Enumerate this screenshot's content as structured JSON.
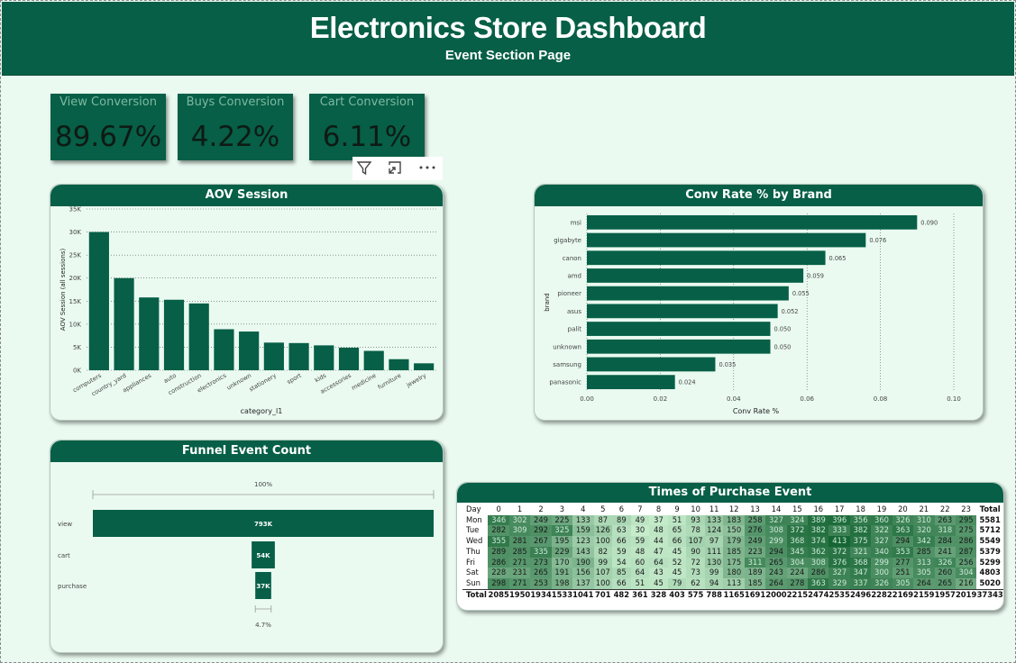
{
  "header": {
    "title": "Electronics Store Dashboard",
    "subtitle": "Event Section Page"
  },
  "kpis": [
    {
      "label": "View Conversion",
      "value": "89.67%"
    },
    {
      "label": "Buys Conversion",
      "value": "4.22%"
    },
    {
      "label": "Cart Conversion",
      "value": "6.11%"
    }
  ],
  "toolbar": {
    "filter_icon": "filter-icon",
    "focus_icon": "expand-icon",
    "more_icon": "more-options-icon"
  },
  "colors": {
    "brand": "#065f46",
    "bar": "#065f46",
    "bg": "#eafaf1"
  },
  "chart_data": [
    {
      "id": "aov",
      "type": "bar",
      "title": "AOV Session",
      "xlabel": "category_l1",
      "ylabel": "AOV Session (all sessions)",
      "categories": [
        "computers",
        "country_yard",
        "appliances",
        "auto",
        "construction",
        "electronics",
        "unknown",
        "stationery",
        "sport",
        "kids",
        "accessories",
        "medicine",
        "furniture",
        "jewelry"
      ],
      "values": [
        30000,
        20000,
        15800,
        15300,
        14500,
        8900,
        8400,
        6000,
        5900,
        5400,
        4900,
        4200,
        2400,
        1500
      ],
      "ylim": [
        0,
        35000
      ],
      "yticks": [
        "0K",
        "5K",
        "10K",
        "15K",
        "20K",
        "25K",
        "30K",
        "35K"
      ],
      "grid": true
    },
    {
      "id": "brand",
      "type": "bar",
      "orientation": "horizontal",
      "title": "Conv Rate % by Brand",
      "xlabel": "Conv Rate %",
      "ylabel": "brand",
      "categories": [
        "msi",
        "gigabyte",
        "canon",
        "amd",
        "pioneer",
        "asus",
        "palit",
        "unknown",
        "samsung",
        "panasonic"
      ],
      "values": [
        0.09,
        0.076,
        0.065,
        0.059,
        0.055,
        0.052,
        0.05,
        0.05,
        0.035,
        0.024
      ],
      "labels": [
        "0.090",
        "0.076",
        "0.065",
        "0.059",
        "0.055",
        "0.052",
        "0.050",
        "0.050",
        "0.035",
        "0.024"
      ],
      "xlim": [
        0,
        0.1
      ],
      "xticks": [
        "0.00",
        "0.02",
        "0.04",
        "0.06",
        "0.08",
        "0.10"
      ],
      "grid": true
    },
    {
      "id": "funnel",
      "type": "bar",
      "subtype": "funnel",
      "title": "Funnel Event Count",
      "categories": [
        "view",
        "cart",
        "purchase"
      ],
      "values": [
        793000,
        54000,
        37000
      ],
      "labels": [
        "793K",
        "54K",
        "37K"
      ],
      "top_label": "100%",
      "bottom_label": "4.7%"
    },
    {
      "id": "heatmap",
      "type": "heatmap",
      "title": "Times of Purchase Event",
      "corner": "Day",
      "hours": [
        "0",
        "1",
        "2",
        "3",
        "4",
        "5",
        "6",
        "7",
        "8",
        "9",
        "10",
        "11",
        "12",
        "13",
        "14",
        "15",
        "16",
        "17",
        "18",
        "19",
        "20",
        "21",
        "22",
        "23"
      ],
      "total_label": "Total",
      "rows": [
        {
          "day": "Mon",
          "values": [
            346,
            302,
            249,
            225,
            133,
            87,
            89,
            49,
            37,
            51,
            93,
            133,
            183,
            258,
            327,
            324,
            389,
            396,
            356,
            360,
            326,
            310,
            263,
            295
          ],
          "total": "5581"
        },
        {
          "day": "Tue",
          "values": [
            282,
            309,
            292,
            325,
            159,
            126,
            63,
            30,
            48,
            65,
            78,
            124,
            150,
            276,
            308,
            372,
            382,
            333,
            382,
            322,
            363,
            320,
            318,
            275
          ],
          "total": "5712"
        },
        {
          "day": "Wed",
          "values": [
            355,
            281,
            267,
            195,
            123,
            100,
            66,
            59,
            44,
            66,
            107,
            97,
            179,
            249,
            299,
            368,
            374,
            413,
            375,
            327,
            294,
            342,
            284,
            286
          ],
          "total": "5549"
        },
        {
          "day": "Thu",
          "values": [
            289,
            285,
            335,
            229,
            143,
            82,
            59,
            48,
            47,
            45,
            90,
            111,
            185,
            223,
            294,
            345,
            362,
            372,
            321,
            340,
            353,
            285,
            241,
            287
          ],
          "total": "5379"
        },
        {
          "day": "Fri",
          "values": [
            286,
            271,
            273,
            170,
            190,
            99,
            54,
            60,
            64,
            52,
            72,
            130,
            175,
            311,
            265,
            304,
            308,
            376,
            368,
            299,
            277,
            313,
            326,
            256
          ],
          "total": "5299"
        },
        {
          "day": "Sat",
          "values": [
            228,
            231,
            265,
            191,
            156,
            107,
            85,
            64,
            43,
            45,
            73,
            99,
            180,
            189,
            243,
            224,
            286,
            327,
            347,
            300,
            251,
            305,
            260,
            304
          ],
          "total": "4803"
        },
        {
          "day": "Sun",
          "values": [
            298,
            271,
            253,
            198,
            137,
            100,
            66,
            51,
            45,
            79,
            62,
            94,
            113,
            185,
            264,
            278,
            363,
            329,
            337,
            326,
            305,
            264,
            265,
            216
          ],
          "total": "5020"
        }
      ],
      "totals": {
        "label": "Total",
        "values": [
          "2085",
          "1950",
          "1934",
          "1533",
          "1041",
          "701",
          "482",
          "361",
          "328",
          "403",
          "575",
          "788",
          "1165",
          "1691",
          "2000",
          "2215",
          "2474",
          "2535",
          "2496",
          "2282",
          "2169",
          "2159",
          "1957",
          "2019"
        ],
        "grand": "37343"
      }
    }
  ]
}
